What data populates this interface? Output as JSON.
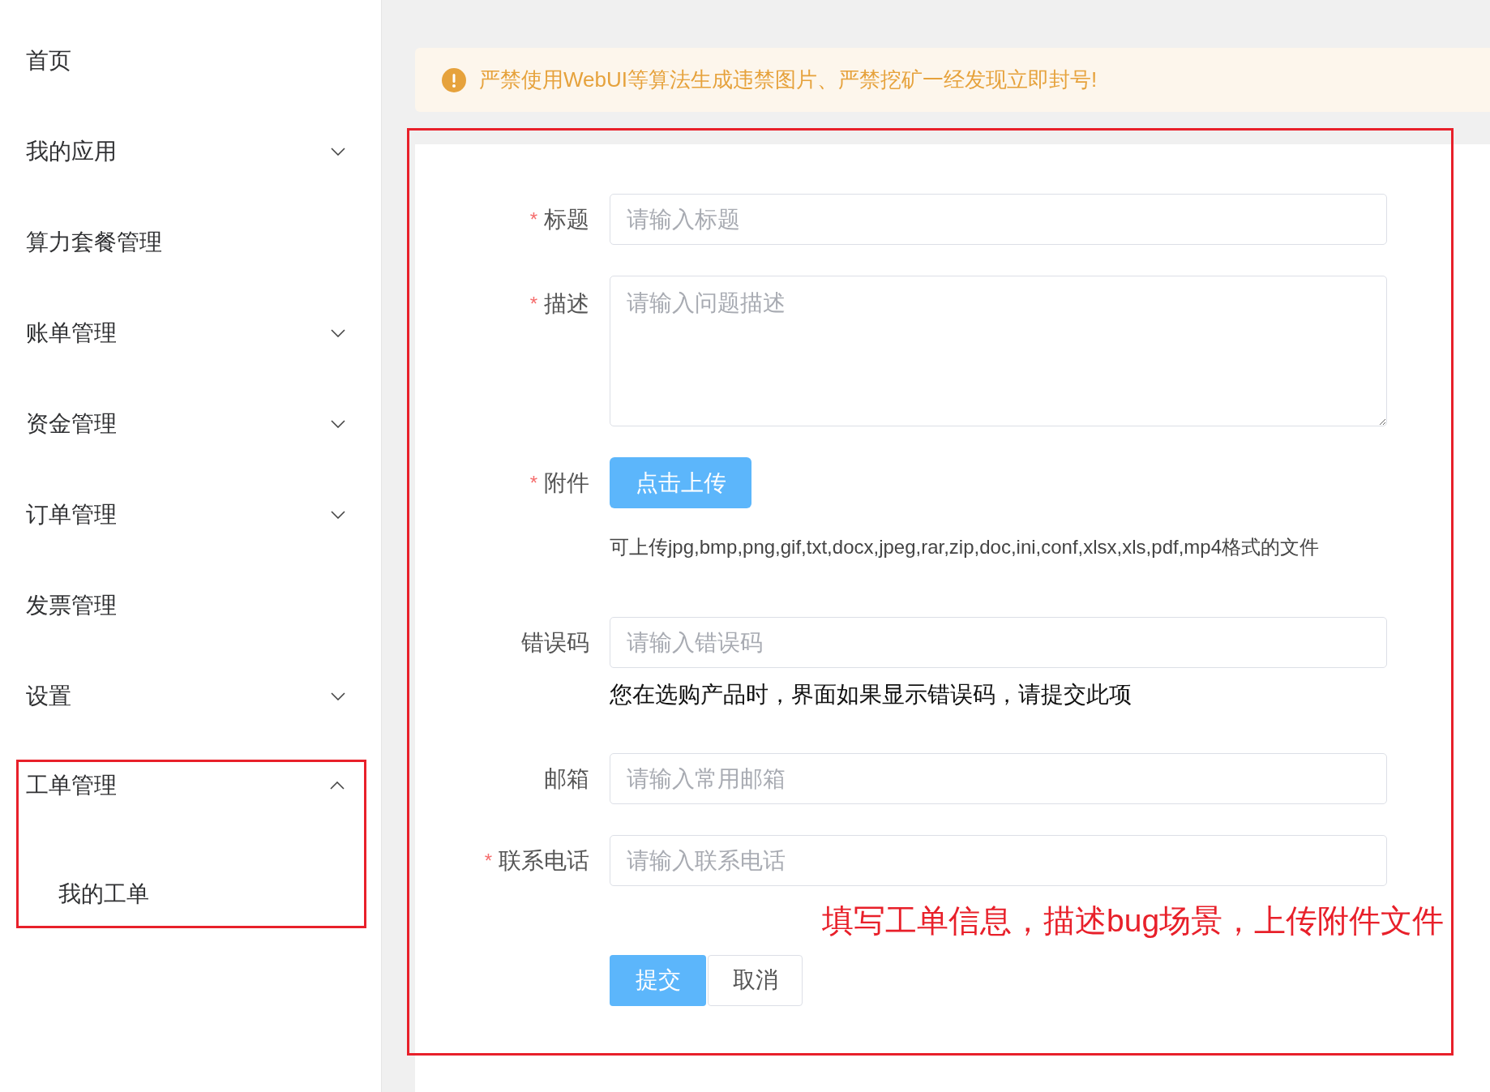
{
  "sidebar": {
    "items": [
      {
        "label": "首页",
        "expandable": false,
        "highlighted": false
      },
      {
        "label": "我的应用",
        "expandable": true,
        "expanded": false,
        "highlighted": false
      },
      {
        "label": "算力套餐管理",
        "expandable": false,
        "highlighted": false
      },
      {
        "label": "账单管理",
        "expandable": true,
        "expanded": false,
        "highlighted": false
      },
      {
        "label": "资金管理",
        "expandable": true,
        "expanded": false,
        "highlighted": false
      },
      {
        "label": "订单管理",
        "expandable": true,
        "expanded": false,
        "highlighted": false
      },
      {
        "label": "发票管理",
        "expandable": false,
        "highlighted": false
      },
      {
        "label": "设置",
        "expandable": true,
        "expanded": false,
        "highlighted": false
      },
      {
        "label": "工单管理",
        "expandable": true,
        "expanded": true,
        "highlighted": true,
        "children": [
          {
            "label": "我的工单"
          }
        ]
      }
    ]
  },
  "alert": {
    "text": "严禁使用WebUI等算法生成违禁图片、严禁挖矿一经发现立即封号!"
  },
  "form": {
    "fields": [
      {
        "kind": "input",
        "label": "标题",
        "required_mark": "*",
        "placeholder": "请输入标题"
      },
      {
        "kind": "textarea",
        "label": "描述",
        "required_mark": "*",
        "placeholder": "请输入问题描述"
      },
      {
        "kind": "upload",
        "label": "附件",
        "required_mark": "*",
        "button": "点击上传",
        "hint": "可上传jpg,bmp,png,gif,txt,docx,jpeg,rar,zip,doc,ini,conf,xlsx,xls,pdf,mp4格式的文件"
      },
      {
        "kind": "input",
        "label": "错误码",
        "placeholder": "请输入错误码",
        "hint": "您在选购产品时，界面如果显示错误码，请提交此项"
      },
      {
        "kind": "input",
        "label": "邮箱",
        "placeholder": "请输入常用邮箱"
      },
      {
        "kind": "input",
        "label": "联系电话",
        "required_mark": "*",
        "placeholder": "请输入联系电话"
      }
    ],
    "annotation": "填写工单信息，描述bug场景，上传附件文件",
    "buttons": [
      {
        "kind": "primary",
        "label": "提交"
      },
      {
        "kind": "default",
        "label": "取消"
      }
    ]
  }
}
